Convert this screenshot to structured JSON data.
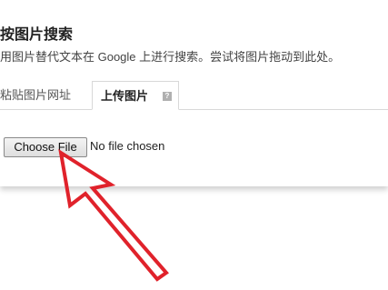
{
  "dialog": {
    "title": "按图片搜索",
    "subtitle": "用图片替代文本在 Google 上进行搜索。尝试将图片拖动到此处。"
  },
  "tabs": [
    {
      "label": "粘贴图片网址",
      "active": false
    },
    {
      "label": "上传图片",
      "active": true,
      "help_icon": "?"
    }
  ],
  "upload": {
    "button_label": "Choose File",
    "status": "No file chosen"
  },
  "colors": {
    "annotation_arrow": "#e0222b"
  }
}
